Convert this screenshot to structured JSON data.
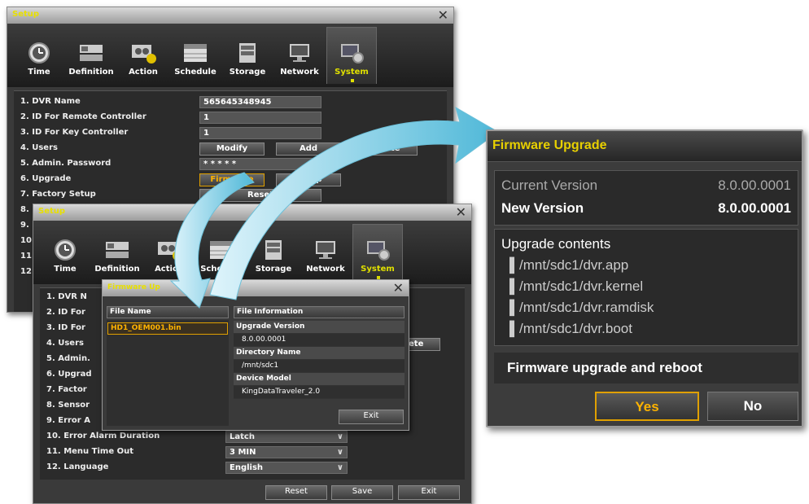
{
  "tabs": [
    {
      "label": "Time",
      "icon": "clock-icon"
    },
    {
      "label": "Definition",
      "icon": "dvr-icon"
    },
    {
      "label": "Action",
      "icon": "camera-alert-icon"
    },
    {
      "label": "Schedule",
      "icon": "calendar-icon"
    },
    {
      "label": "Storage",
      "icon": "storage-icon"
    },
    {
      "label": "Network",
      "icon": "monitor-icon"
    },
    {
      "label": "System",
      "icon": "system-gear-icon"
    }
  ],
  "win1": {
    "title": "Setup",
    "close": "✕",
    "rows": [
      {
        "label": "1. DVR Name",
        "value": "565645348945"
      },
      {
        "label": "2. ID For Remote Controller",
        "value": "1"
      },
      {
        "label": "3. ID For Key Controller",
        "value": "1"
      },
      {
        "label": "4. Users",
        "b1": "Modify",
        "b2": "Add",
        "b3": "Delete"
      },
      {
        "label": "5. Admin. Password",
        "value": "* * * * *"
      },
      {
        "label": "6. Upgrade",
        "b1": "Firmware",
        "b2": "Setup"
      },
      {
        "label": "7. Factory Setup",
        "value": "Reset"
      },
      {
        "label": "8."
      },
      {
        "label": "9."
      },
      {
        "label": "10"
      },
      {
        "label": "11"
      },
      {
        "label": "12"
      }
    ]
  },
  "win2": {
    "title": "Setup",
    "close": "✕",
    "rows": [
      {
        "label": "1. DVR N"
      },
      {
        "label": "2. ID For"
      },
      {
        "label": "3. ID For"
      },
      {
        "label": "4. Users",
        "partial": "ete"
      },
      {
        "label": "5. Admin."
      },
      {
        "label": "6. Upgrad"
      },
      {
        "label": "7. Factor"
      },
      {
        "label": "8. Sensor"
      },
      {
        "label": "9. Error A"
      },
      {
        "label": "10. Error Alarm Duration",
        "value": "Latch"
      },
      {
        "label": "11. Menu Time Out",
        "value": "3 MIN"
      },
      {
        "label": "12. Language",
        "value": "English"
      }
    ],
    "buttons": {
      "reset": "Reset",
      "save": "Save",
      "exit": "Exit"
    }
  },
  "fw_small": {
    "title": "Firmware Up",
    "close": "✕",
    "file_name_header": "File Name",
    "file_info_header": "File Information",
    "file": "HD1_OEM001.bin",
    "info": [
      {
        "label": "Upgrade Version",
        "value": "8.0.00.0001"
      },
      {
        "label": "Directory Name",
        "value": "/mnt/sdc1"
      },
      {
        "label": "Device Model",
        "value": "KingDataTraveler_2.0"
      }
    ],
    "exit": "Exit"
  },
  "fw_big": {
    "title": "Firmware Upgrade",
    "current_label": "Current Version",
    "current_value": "8.0.00.0001",
    "new_label": "New Version",
    "new_value": "8.0.00.0001",
    "contents_label": "Upgrade contents",
    "contents": [
      "/mnt/sdc1/dvr.app",
      "/mnt/sdc1/dvr.kernel",
      "/mnt/sdc1/dvr.ramdisk",
      "/mnt/sdc1/dvr.boot"
    ],
    "prompt": "Firmware upgrade and reboot",
    "yes": "Yes",
    "no": "No"
  },
  "colors": {
    "accent_yellow": "#e8d000",
    "highlight_orange": "#ffb300",
    "arrow_teal": "#4fb8d8"
  }
}
